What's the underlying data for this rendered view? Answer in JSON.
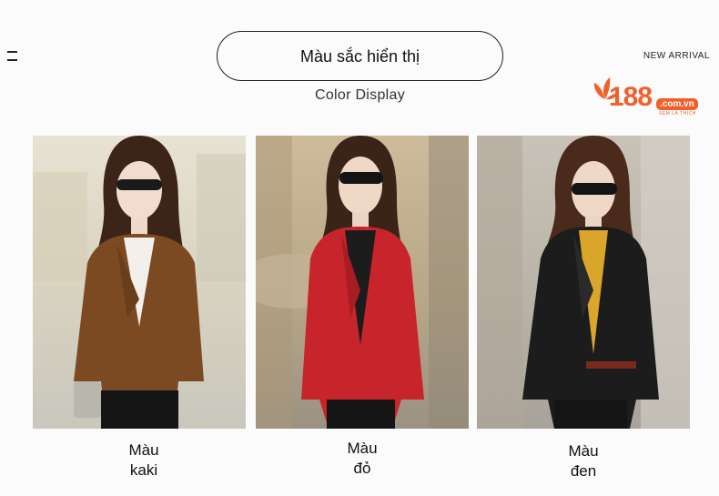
{
  "header": {
    "title": "Màu sắc hiển thị",
    "subtitle": "Color Display",
    "new_arrival": "NEW ARRIVAL"
  },
  "brand": {
    "number": "188",
    "domain": ".com.vn",
    "tagline": "XEM LÀ THÍCH",
    "color": "#f1602a"
  },
  "products": [
    {
      "caption_line1": "Màu",
      "caption_line2": "kaki",
      "jacket_color": "#7b4a22"
    },
    {
      "caption_line1": "Màu",
      "caption_line2": "đỏ",
      "jacket_color": "#c8242b"
    },
    {
      "caption_line1": "Màu",
      "caption_line2": "đen",
      "jacket_color": "#1c1c1c"
    }
  ]
}
